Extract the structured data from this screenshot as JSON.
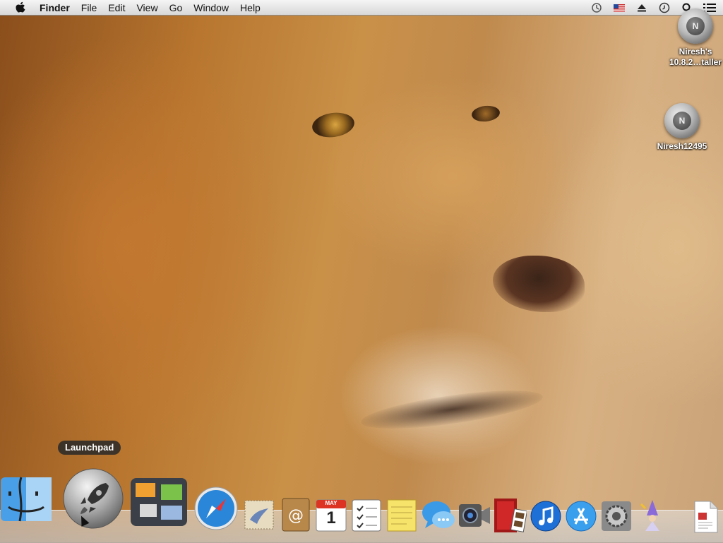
{
  "menubar": {
    "app_name": "Finder",
    "items": [
      "File",
      "Edit",
      "View",
      "Go",
      "Window",
      "Help"
    ],
    "status_icons": [
      "time-machine-icon",
      "us-flag-input-icon",
      "eject-icon",
      "sync-clock-icon",
      "spotlight-search-icon",
      "notification-list-icon"
    ]
  },
  "desktop": {
    "icons": [
      {
        "name": "installer-disk",
        "label_line1": "Niresh's",
        "label_line2": "10.8.2…taller",
        "glyph": "N"
      },
      {
        "name": "niresh-disk",
        "label_line1": "Niresh12495",
        "label_line2": "",
        "glyph": "N"
      }
    ]
  },
  "dock": {
    "tooltip": "Launchpad",
    "items": [
      "finder-icon",
      "launchpad-icon",
      "mission-control-icon",
      "safari-icon",
      "mail-icon",
      "contacts-icon",
      "calendar-icon",
      "reminders-icon",
      "notes-icon",
      "messages-icon",
      "facetime-icon",
      "photo-booth-icon",
      "itunes-icon",
      "app-store-icon",
      "system-preferences-icon",
      "wizard-icon",
      "document-icon"
    ],
    "calendar": {
      "month": "MAY",
      "day": "1"
    }
  },
  "colors": {
    "menubar_top": "#f5f5f5",
    "menubar_bottom": "#d8d8d8",
    "safari_blue": "#2a86d8",
    "itunes_blue": "#1e6fd6"
  }
}
